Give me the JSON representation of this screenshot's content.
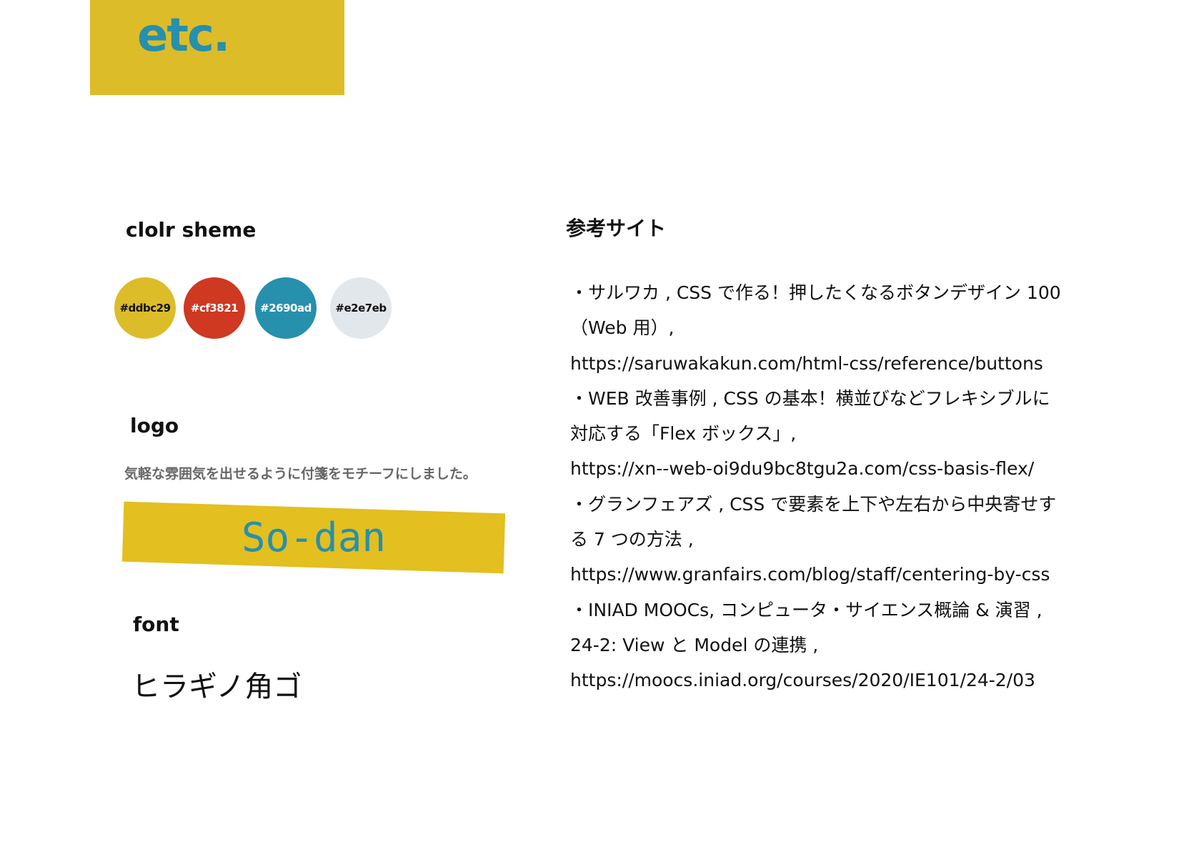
{
  "header": {
    "title": "etc."
  },
  "colors": {
    "header_block": "#ddbc29",
    "header_text": "#2690ad",
    "logo_sticky": "#e3bf20",
    "logo_text": "#2690ad"
  },
  "color_scheme": {
    "heading": "clolr sheme",
    "swatches": [
      {
        "label": "#ddbc29",
        "color": "#ddbc29",
        "text_color": "#111111"
      },
      {
        "label": "#cf3821",
        "color": "#cf3821",
        "text_color": "#ffffff"
      },
      {
        "label": "#2690ad",
        "color": "#2690ad",
        "text_color": "#ffffff"
      },
      {
        "label": "#e2e7eb",
        "color": "#e2e7eb",
        "text_color": "#111111"
      }
    ]
  },
  "logo": {
    "heading": "logo",
    "description": "気軽な雰囲気を出せるように付箋をモチーフにしました。",
    "wordmark": "So-dan"
  },
  "font": {
    "heading": "font",
    "sample": "ヒラギノ角ゴ"
  },
  "references": {
    "heading": "参考サイト",
    "items": [
      {
        "lines": [
          "・サルワカ , CSS で作る！押したくなるボタンデザイン 100",
          "（Web 用）,",
          "https://saruwakakun.com/html-css/reference/buttons"
        ]
      },
      {
        "lines": [
          "・WEB 改善事例 , CSS の基本！横並びなどフレキシブルに",
          "対応する「Flex ボックス」,",
          "https://xn--web-oi9du9bc8tgu2a.com/css-basis-flex/"
        ]
      },
      {
        "lines": [
          "・グランフェアズ , CSS で要素を上下や左右から中央寄せす",
          "る 7 つの方法 ,",
          "https://www.granfairs.com/blog/staff/centering-by-css"
        ]
      },
      {
        "lines": [
          "・INIAD MOOCs, コンピュータ・サイエンス概論 & 演習 ,",
          "24-2: View と Model の連携 ,",
          "https://moocs.iniad.org/courses/2020/IE101/24-2/03"
        ]
      }
    ]
  }
}
